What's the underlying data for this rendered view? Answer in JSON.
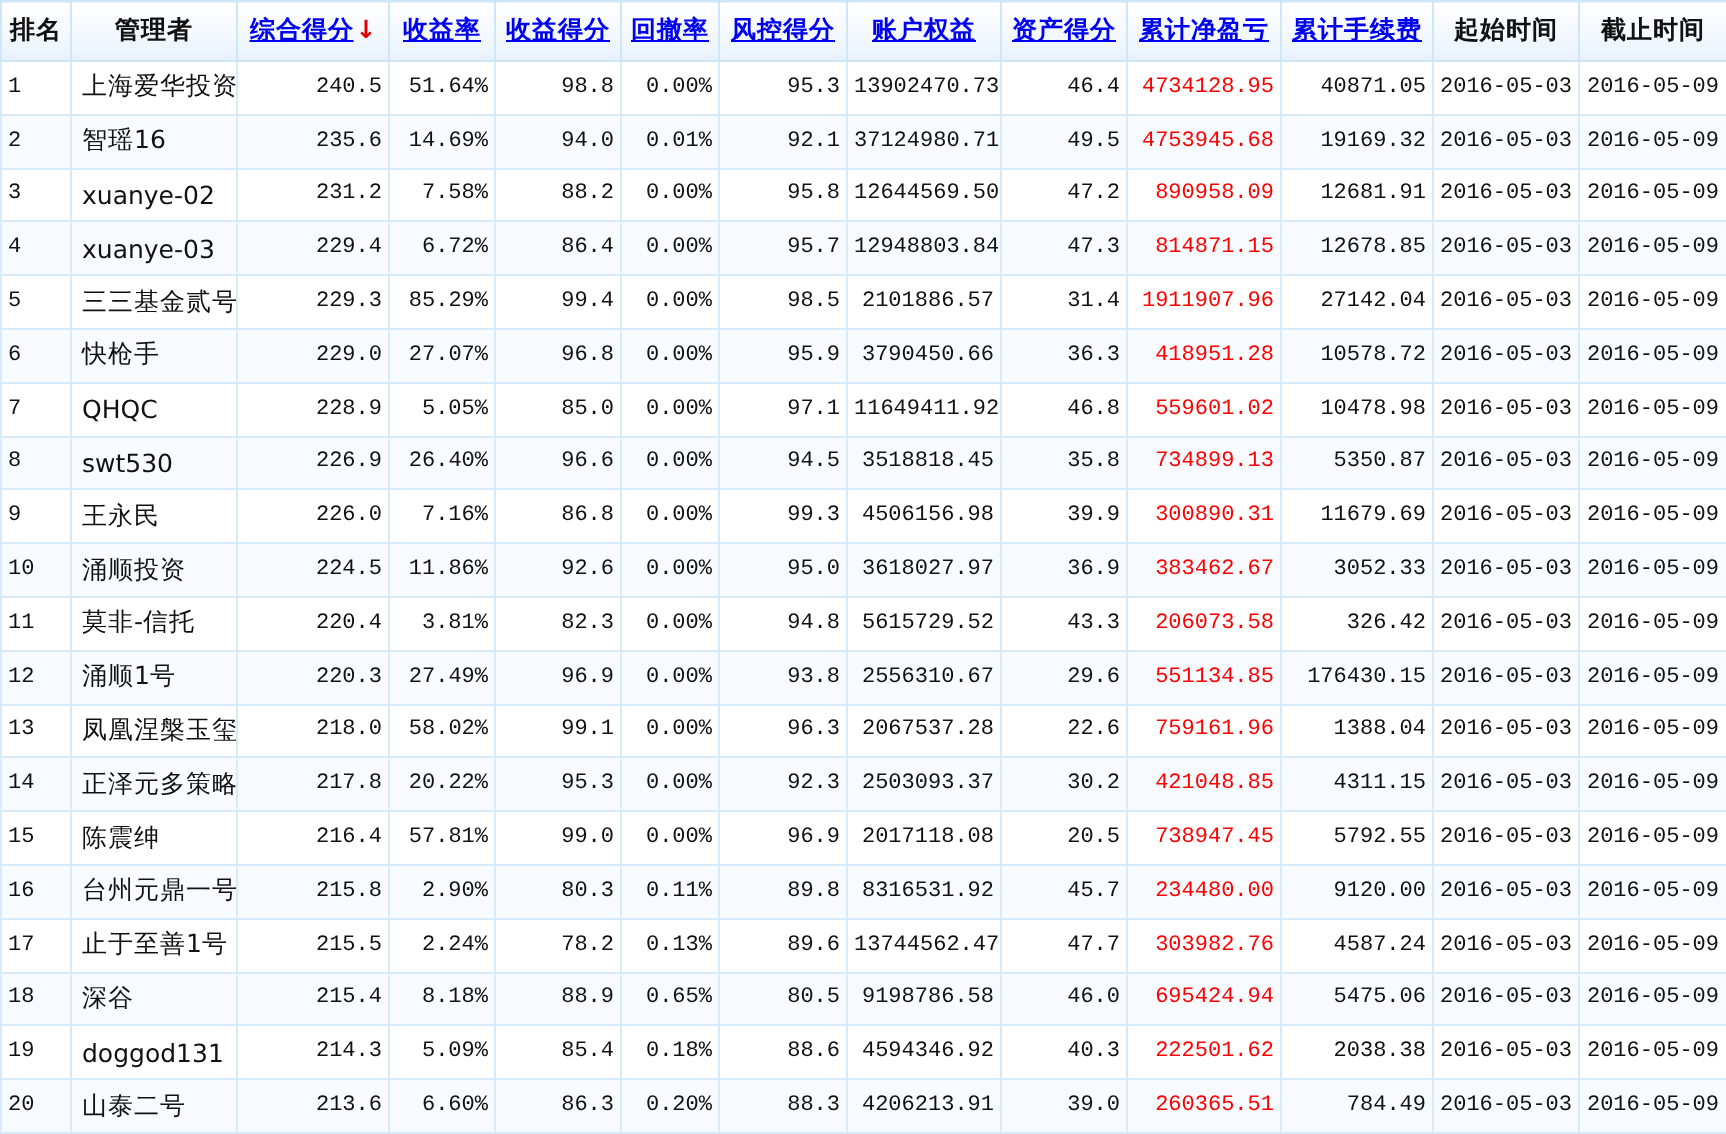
{
  "table": {
    "columns": [
      {
        "label": "排名",
        "link": false,
        "emphasis": false
      },
      {
        "label": "管理者",
        "link": false,
        "emphasis": false
      },
      {
        "label": "综合得分",
        "link": true,
        "sort_mark": "↓",
        "emphasis": false
      },
      {
        "label": "收益率",
        "link": true,
        "emphasis": false
      },
      {
        "label": "收益得分",
        "link": true,
        "emphasis": false
      },
      {
        "label": "回撤率",
        "link": true,
        "emphasis": false
      },
      {
        "label": "风控得分",
        "link": true,
        "emphasis": false
      },
      {
        "label": "账户权益",
        "link": true,
        "emphasis": false
      },
      {
        "label": "资产得分",
        "link": true,
        "emphasis": false
      },
      {
        "label": "累计净盈亏",
        "link": true,
        "emphasis": true
      },
      {
        "label": "累计手续费",
        "link": true,
        "emphasis": false
      },
      {
        "label": "起始时间",
        "link": false,
        "emphasis": false
      },
      {
        "label": "截止时间",
        "link": false,
        "emphasis": false
      }
    ],
    "rows": [
      [
        "1",
        "上海爱华投资",
        "240.5",
        "51.64%",
        "98.8",
        "0.00%",
        "95.3",
        "13902470.73",
        "46.4",
        "4734128.95",
        "40871.05",
        "2016-05-03",
        "2016-05-09"
      ],
      [
        "2",
        "智瑶16",
        "235.6",
        "14.69%",
        "94.0",
        "0.01%",
        "92.1",
        "37124980.71",
        "49.5",
        "4753945.68",
        "19169.32",
        "2016-05-03",
        "2016-05-09"
      ],
      [
        "3",
        "xuanye-02",
        "231.2",
        "7.58%",
        "88.2",
        "0.00%",
        "95.8",
        "12644569.50",
        "47.2",
        "890958.09",
        "12681.91",
        "2016-05-03",
        "2016-05-09"
      ],
      [
        "4",
        "xuanye-03",
        "229.4",
        "6.72%",
        "86.4",
        "0.00%",
        "95.7",
        "12948803.84",
        "47.3",
        "814871.15",
        "12678.85",
        "2016-05-03",
        "2016-05-09"
      ],
      [
        "5",
        "三三基金贰号",
        "229.3",
        "85.29%",
        "99.4",
        "0.00%",
        "98.5",
        "2101886.57",
        "31.4",
        "1911907.96",
        "27142.04",
        "2016-05-03",
        "2016-05-09"
      ],
      [
        "6",
        "快枪手",
        "229.0",
        "27.07%",
        "96.8",
        "0.00%",
        "95.9",
        "3790450.66",
        "36.3",
        "418951.28",
        "10578.72",
        "2016-05-03",
        "2016-05-09"
      ],
      [
        "7",
        "QHQC",
        "228.9",
        "5.05%",
        "85.0",
        "0.00%",
        "97.1",
        "11649411.92",
        "46.8",
        "559601.02",
        "10478.98",
        "2016-05-03",
        "2016-05-09"
      ],
      [
        "8",
        "swt530",
        "226.9",
        "26.40%",
        "96.6",
        "0.00%",
        "94.5",
        "3518818.45",
        "35.8",
        "734899.13",
        "5350.87",
        "2016-05-03",
        "2016-05-09"
      ],
      [
        "9",
        "王永民",
        "226.0",
        "7.16%",
        "86.8",
        "0.00%",
        "99.3",
        "4506156.98",
        "39.9",
        "300890.31",
        "11679.69",
        "2016-05-03",
        "2016-05-09"
      ],
      [
        "10",
        "涌顺投资",
        "224.5",
        "11.86%",
        "92.6",
        "0.00%",
        "95.0",
        "3618027.97",
        "36.9",
        "383462.67",
        "3052.33",
        "2016-05-03",
        "2016-05-09"
      ],
      [
        "11",
        "莫非-信托",
        "220.4",
        "3.81%",
        "82.3",
        "0.00%",
        "94.8",
        "5615729.52",
        "43.3",
        "206073.58",
        "326.42",
        "2016-05-03",
        "2016-05-09"
      ],
      [
        "12",
        "涌顺1号",
        "220.3",
        "27.49%",
        "96.9",
        "0.00%",
        "93.8",
        "2556310.67",
        "29.6",
        "551134.85",
        "176430.15",
        "2016-05-03",
        "2016-05-09"
      ],
      [
        "13",
        "凤凰涅槃玉玺",
        "218.0",
        "58.02%",
        "99.1",
        "0.00%",
        "96.3",
        "2067537.28",
        "22.6",
        "759161.96",
        "1388.04",
        "2016-05-03",
        "2016-05-09"
      ],
      [
        "14",
        "正泽元多策略",
        "217.8",
        "20.22%",
        "95.3",
        "0.00%",
        "92.3",
        "2503093.37",
        "30.2",
        "421048.85",
        "4311.15",
        "2016-05-03",
        "2016-05-09"
      ],
      [
        "15",
        "陈震绅",
        "216.4",
        "57.81%",
        "99.0",
        "0.00%",
        "96.9",
        "2017118.08",
        "20.5",
        "738947.45",
        "5792.55",
        "2016-05-03",
        "2016-05-09"
      ],
      [
        "16",
        "台州元鼎一号",
        "215.8",
        "2.90%",
        "80.3",
        "0.11%",
        "89.8",
        "8316531.92",
        "45.7",
        "234480.00",
        "9120.00",
        "2016-05-03",
        "2016-05-09"
      ],
      [
        "17",
        "止于至善1号",
        "215.5",
        "2.24%",
        "78.2",
        "0.13%",
        "89.6",
        "13744562.47",
        "47.7",
        "303982.76",
        "4587.24",
        "2016-05-03",
        "2016-05-09"
      ],
      [
        "18",
        "深谷",
        "215.4",
        "8.18%",
        "88.9",
        "0.65%",
        "80.5",
        "9198786.58",
        "46.0",
        "695424.94",
        "5475.06",
        "2016-05-03",
        "2016-05-09"
      ],
      [
        "19",
        "doggod131",
        "214.3",
        "5.09%",
        "85.4",
        "0.18%",
        "88.6",
        "4594346.92",
        "40.3",
        "222501.62",
        "2038.38",
        "2016-05-03",
        "2016-05-09"
      ],
      [
        "20",
        "山泰二号",
        "213.6",
        "6.60%",
        "86.3",
        "0.20%",
        "88.3",
        "4206213.91",
        "39.0",
        "260365.51",
        "784.49",
        "2016-05-03",
        "2016-05-09"
      ]
    ]
  }
}
